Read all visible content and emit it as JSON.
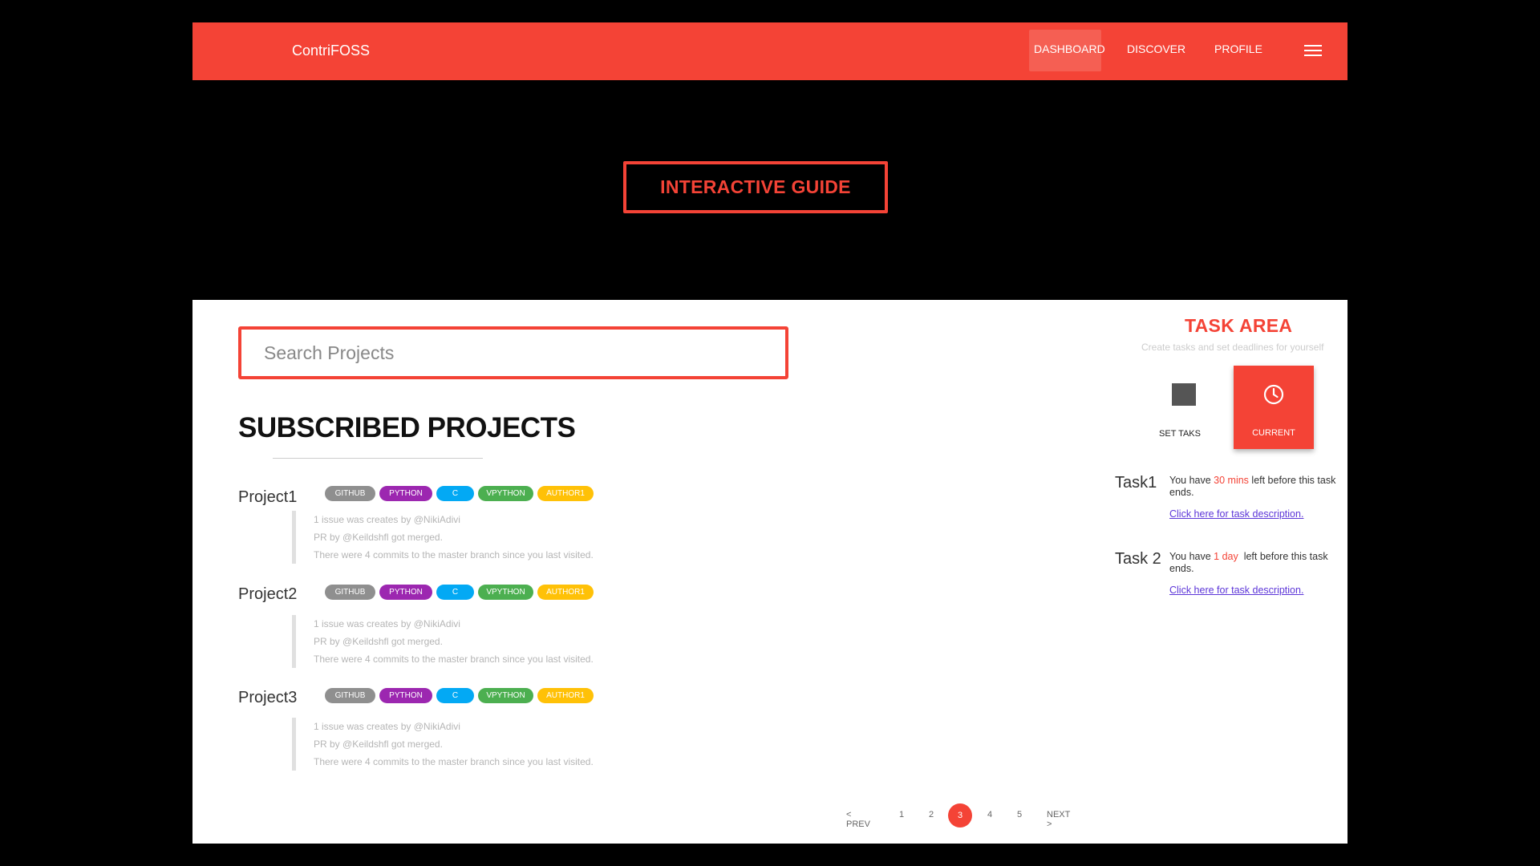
{
  "nav": {
    "brand": "ContriFOSS",
    "links": [
      "DASHBOARD",
      "DISCOVER",
      "PROFILE"
    ]
  },
  "guide_button": "INTERACTIVE GUIDE",
  "search": {
    "placeholder": "Search Projects"
  },
  "section_title": "SUBSCRIBED PROJECTS",
  "tag_colors": {
    "GITHUB": "#8f8f8f",
    "PYTHON": "#9c27b0",
    "C": "#03a9f4",
    "VPYTHON": "#4caf50",
    "AUTHOR1": "#ffc107"
  },
  "projects": [
    {
      "name": "Project1",
      "tags": [
        "GITHUB",
        "PYTHON",
        "C",
        "VPYTHON",
        "AUTHOR1"
      ],
      "activity": [
        "1 issue was creates by @NikiAdivi",
        "PR by @Keildshfl got merged.",
        "There were 4 commits to the master branch since you last visited."
      ]
    },
    {
      "name": "Project2",
      "tags": [
        "GITHUB",
        "PYTHON",
        "C",
        "VPYTHON",
        "AUTHOR1"
      ],
      "activity": [
        "1 issue was creates by @NikiAdivi",
        "PR by @Keildshfl got merged.",
        "There were 4 commits to the master branch since you last visited."
      ]
    },
    {
      "name": "Project3",
      "tags": [
        "GITHUB",
        "PYTHON",
        "C",
        "VPYTHON",
        "AUTHOR1"
      ],
      "activity": [
        "1 issue was creates by @NikiAdivi",
        "PR by @Keildshfl got merged.",
        "There were 4 commits to the master branch since you last visited."
      ]
    }
  ],
  "pagination": {
    "prev": "< PREV",
    "pages": [
      "1",
      "2",
      "3",
      "4",
      "5"
    ],
    "current": "3",
    "next": "NEXT >"
  },
  "task_area": {
    "title": "TASK AREA",
    "subtitle": "Create tasks and set deadlines for yourself",
    "set_label": "SET TAKS",
    "current_label": "CURRENT",
    "tasks": [
      {
        "name": "Task1",
        "prefix": "You have ",
        "time": "30 mins",
        "suffix": " left before this task ends.",
        "link": "Click here for task description."
      },
      {
        "name": "Task 2",
        "prefix": "You have ",
        "time": "1 day",
        "suffix": "  left before this task ends.",
        "link": "Click here for task description."
      }
    ]
  }
}
